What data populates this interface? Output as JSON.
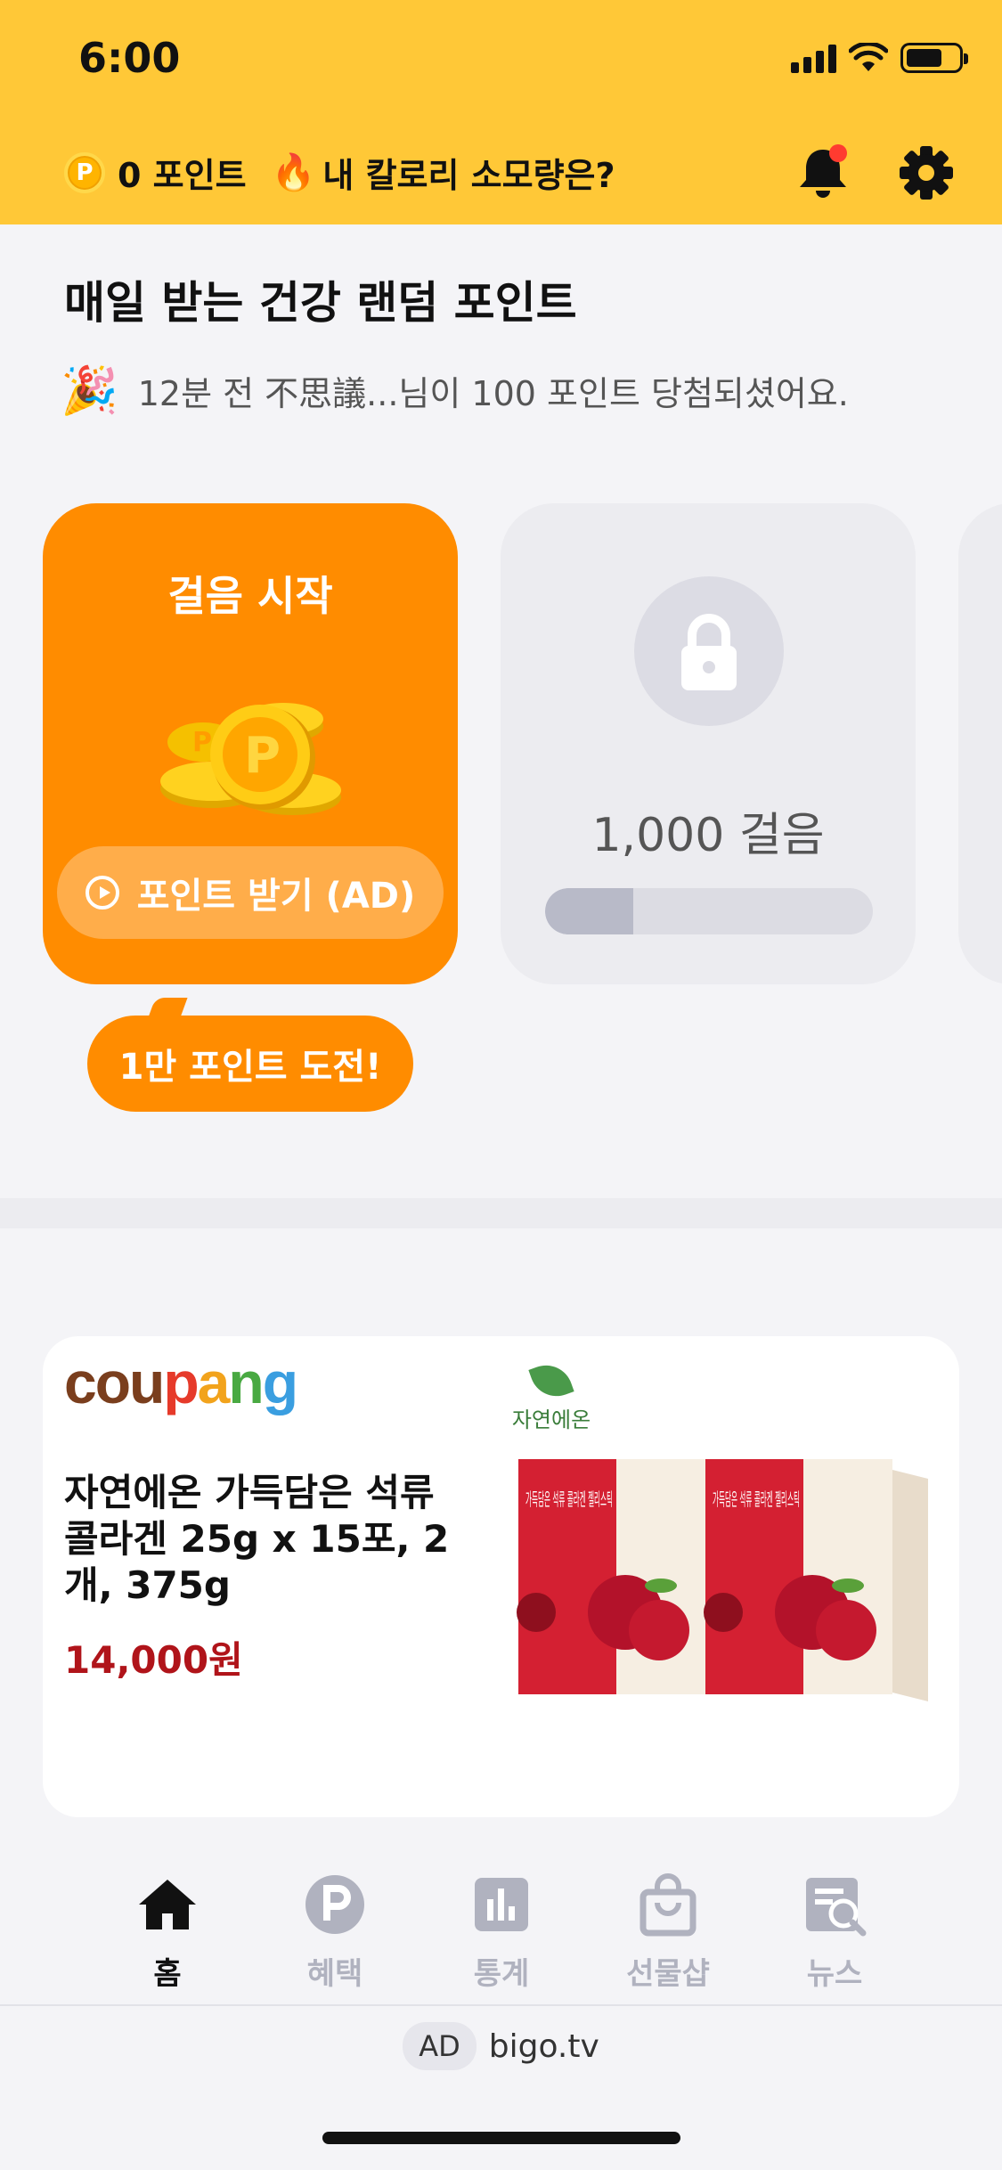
{
  "status_bar": {
    "time": "6:00"
  },
  "header": {
    "points_label": "0 포인트",
    "calorie_label": "내 칼로리 소모량은?",
    "coin_icon_text": "P",
    "colors": {
      "background": "#ffc837",
      "notification_dot": "#ff3b30"
    }
  },
  "random_points": {
    "title": "매일 받는 건강 랜덤 포인트",
    "winner_message": "12분 전 不思議...님이 100 포인트 당첨되셨어요."
  },
  "cards": {
    "start": {
      "title": "걸음 시작",
      "button_label": "포인트 받기 (AD)",
      "coin_glyph": "P",
      "bubble_text": "1만 포인트 도전!",
      "color": "#ff8c00"
    },
    "locked": {
      "steps_label": "1,000 걸음",
      "progress_fraction": 0.27
    }
  },
  "ad": {
    "retailer_parts": [
      "cou",
      "p",
      "a",
      "n",
      "g"
    ],
    "brand_name": "자연에온",
    "product_title": "자연에온 가득담은 석류 콜라겐 25g x 15포, 2개, 375g",
    "price": "14,000원",
    "package_text": "가득담은 석류 콜라겐 젤리스틱"
  },
  "tabs": [
    {
      "label": "홈",
      "icon": "home-icon",
      "active": true
    },
    {
      "label": "혜택",
      "icon": "points-p-icon",
      "active": false
    },
    {
      "label": "통계",
      "icon": "bar-chart-icon",
      "active": false
    },
    {
      "label": "선물샵",
      "icon": "shopping-bag-icon",
      "active": false
    },
    {
      "label": "뉴스",
      "icon": "news-search-icon",
      "active": false
    }
  ],
  "footer_ad": {
    "badge": "AD",
    "domain": "bigo.tv"
  }
}
